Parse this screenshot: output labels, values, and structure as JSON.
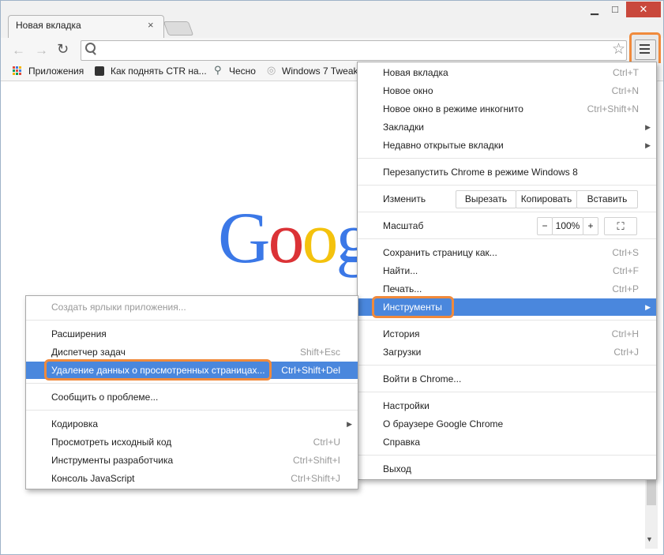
{
  "window": {
    "minimize_label": "▁",
    "maximize_label": "□",
    "close_label": "✕"
  },
  "tab": {
    "title": "Новая вкладка",
    "close_label": "×"
  },
  "toolbar": {
    "back_icon": "←",
    "forward_icon": "→",
    "reload_icon": "↻",
    "star_icon": "☆",
    "address_value": ""
  },
  "bookmarks": [
    {
      "label": "Приложения",
      "icon": "apps-grid-icon"
    },
    {
      "label": "Как поднять CTR на...",
      "icon": "ctr-site-icon"
    },
    {
      "label": "Чесно",
      "icon": "chesno-icon"
    },
    {
      "label": "Windows 7 Tweak",
      "icon": "windows-tweak-icon"
    }
  ],
  "logo": {
    "g1": "G",
    "o1": "o",
    "o2": "o",
    "g2": "g"
  },
  "colors": {
    "accent_highlight": "#4a87dd",
    "annotation_orange": "#f08a3c",
    "close_red": "#c9483c"
  },
  "main_menu": {
    "new_tab": {
      "label": "Новая вкладка",
      "shortcut": "Ctrl+T"
    },
    "new_window": {
      "label": "Новое окно",
      "shortcut": "Ctrl+N"
    },
    "incognito": {
      "label": "Новое окно в режиме инкогнито",
      "shortcut": "Ctrl+Shift+N"
    },
    "bookmarks": {
      "label": "Закладки"
    },
    "recent_tabs": {
      "label": "Недавно открытые вкладки"
    },
    "relaunch": {
      "label": "Перезапустить Chrome в режиме Windows 8"
    },
    "edit": {
      "label": "Изменить",
      "cut": "Вырезать",
      "copy": "Копировать",
      "paste": "Вставить"
    },
    "zoom": {
      "label": "Масштаб",
      "minus": "−",
      "value": "100%",
      "plus": "+",
      "fullscreen": "⛶"
    },
    "save_page": {
      "label": "Сохранить страницу как...",
      "shortcut": "Ctrl+S"
    },
    "find": {
      "label": "Найти...",
      "shortcut": "Ctrl+F"
    },
    "print": {
      "label": "Печать...",
      "shortcut": "Ctrl+P"
    },
    "tools": {
      "label": "Инструменты"
    },
    "history": {
      "label": "История",
      "shortcut": "Ctrl+H"
    },
    "downloads": {
      "label": "Загрузки",
      "shortcut": "Ctrl+J"
    },
    "signin": {
      "label": "Войти в Chrome..."
    },
    "settings": {
      "label": "Настройки"
    },
    "about": {
      "label": "О браузере Google Chrome"
    },
    "help": {
      "label": "Справка"
    },
    "exit": {
      "label": "Выход"
    }
  },
  "tools_submenu": {
    "create_shortcuts": {
      "label": "Создать ярлыки приложения..."
    },
    "extensions": {
      "label": "Расширения"
    },
    "task_manager": {
      "label": "Диспетчер задач",
      "shortcut": "Shift+Esc"
    },
    "clear_data": {
      "label": "Удаление данных о просмотренных страницах...",
      "shortcut": "Ctrl+Shift+Del"
    },
    "report_issue": {
      "label": "Сообщить о проблеме..."
    },
    "encoding": {
      "label": "Кодировка"
    },
    "view_source": {
      "label": "Просмотреть исходный код",
      "shortcut": "Ctrl+U"
    },
    "dev_tools": {
      "label": "Инструменты разработчика",
      "shortcut": "Ctrl+Shift+I"
    },
    "js_console": {
      "label": "Консоль JavaScript",
      "shortcut": "Ctrl+Shift+J"
    }
  }
}
